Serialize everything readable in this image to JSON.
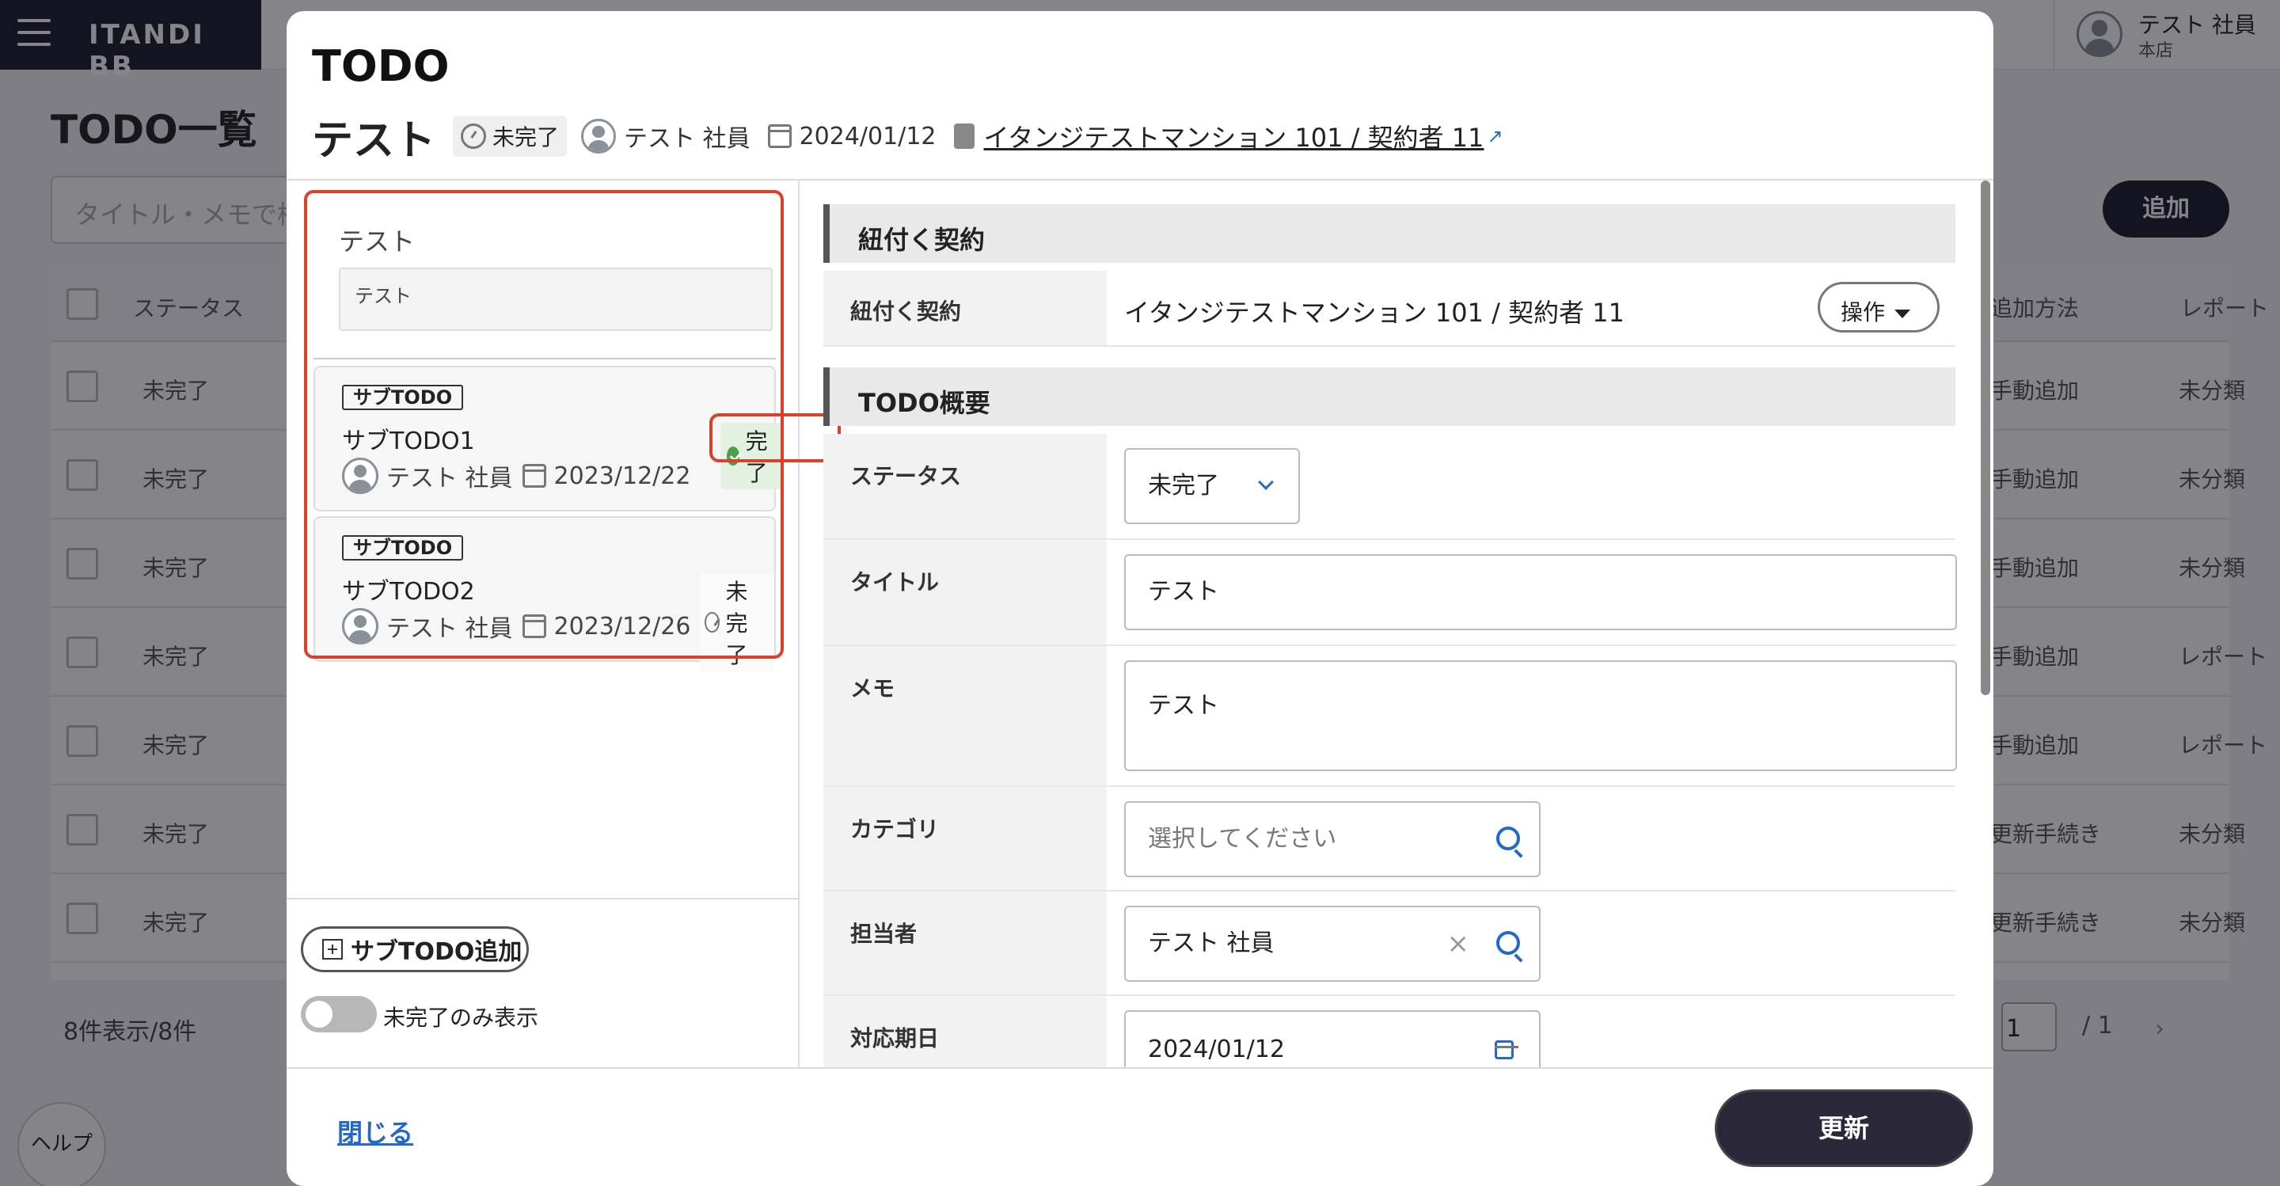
{
  "topbar": {
    "logo": "ITANDI BB",
    "user_name": "テスト 社員",
    "branch": "本店"
  },
  "background_page": {
    "title": "TODO一覧",
    "search_placeholder": "タイトル・メモで検索",
    "add_button": "追加",
    "columns": {
      "status": "ステータス",
      "add_method": "追加方法",
      "report": "レポート"
    },
    "rows": [
      {
        "status": "未完了",
        "method": "手動追加",
        "report": "未分類"
      },
      {
        "status": "未完了",
        "method": "手動追加",
        "report": "未分類"
      },
      {
        "status": "未完了",
        "method": "手動追加",
        "report": "未分類"
      },
      {
        "status": "未完了",
        "method": "手動追加",
        "report": "レポート"
      },
      {
        "status": "未完了",
        "method": "手動追加",
        "report": "レポート"
      },
      {
        "status": "未完了",
        "method": "更新手続き",
        "report": "未分類"
      },
      {
        "status": "未完了",
        "method": "更新手続き",
        "report": "未分類"
      }
    ],
    "count_text": "8件表示/8件",
    "page_current": "1",
    "page_total": "/ 1",
    "help_label": "ヘルプ"
  },
  "modal": {
    "title": "TODO",
    "todo_title": "テスト",
    "status": "未完了",
    "assignee": "テスト 社員",
    "date": "2024/01/12",
    "contract_link": "イタンジテストマンション 101 / 契約者 11",
    "main_item": {
      "title": "テスト",
      "memo": "テスト"
    },
    "subtodos": [
      {
        "tag": "サブTODO",
        "name": "サブTODO1",
        "status": "完了",
        "assignee": "テスト 社員",
        "date": "2023/12/22"
      },
      {
        "tag": "サブTODO",
        "name": "サブTODO2",
        "status": "未完了",
        "assignee": "テスト 社員",
        "date": "2023/12/26"
      }
    ],
    "add_subtodo": "サブTODO追加",
    "toggle_label": "未完了のみ表示",
    "sections": {
      "contract": "紐付く契約",
      "overview": "TODO概要"
    },
    "fields": {
      "contract_label": "紐付く契約",
      "contract_value": "イタンジテストマンション 101 / 契約者 11",
      "operation": "操作",
      "status_label": "ステータス",
      "status_value": "未完了",
      "title_label": "タイトル",
      "title_value": "テスト",
      "memo_label": "メモ",
      "memo_value": "テスト",
      "category_label": "カテゴリ",
      "category_placeholder": "選択してください",
      "assignee_label": "担当者",
      "assignee_value": "テスト 社員",
      "due_label": "対応期日",
      "due_value": "2024/01/12"
    },
    "close_link": "閉じる",
    "update_button": "更新"
  },
  "colors": {
    "accent_red": "#d9412b",
    "link_blue": "#2468c8",
    "dark": "#1f1e2c",
    "done_green": "#4aa14a"
  }
}
